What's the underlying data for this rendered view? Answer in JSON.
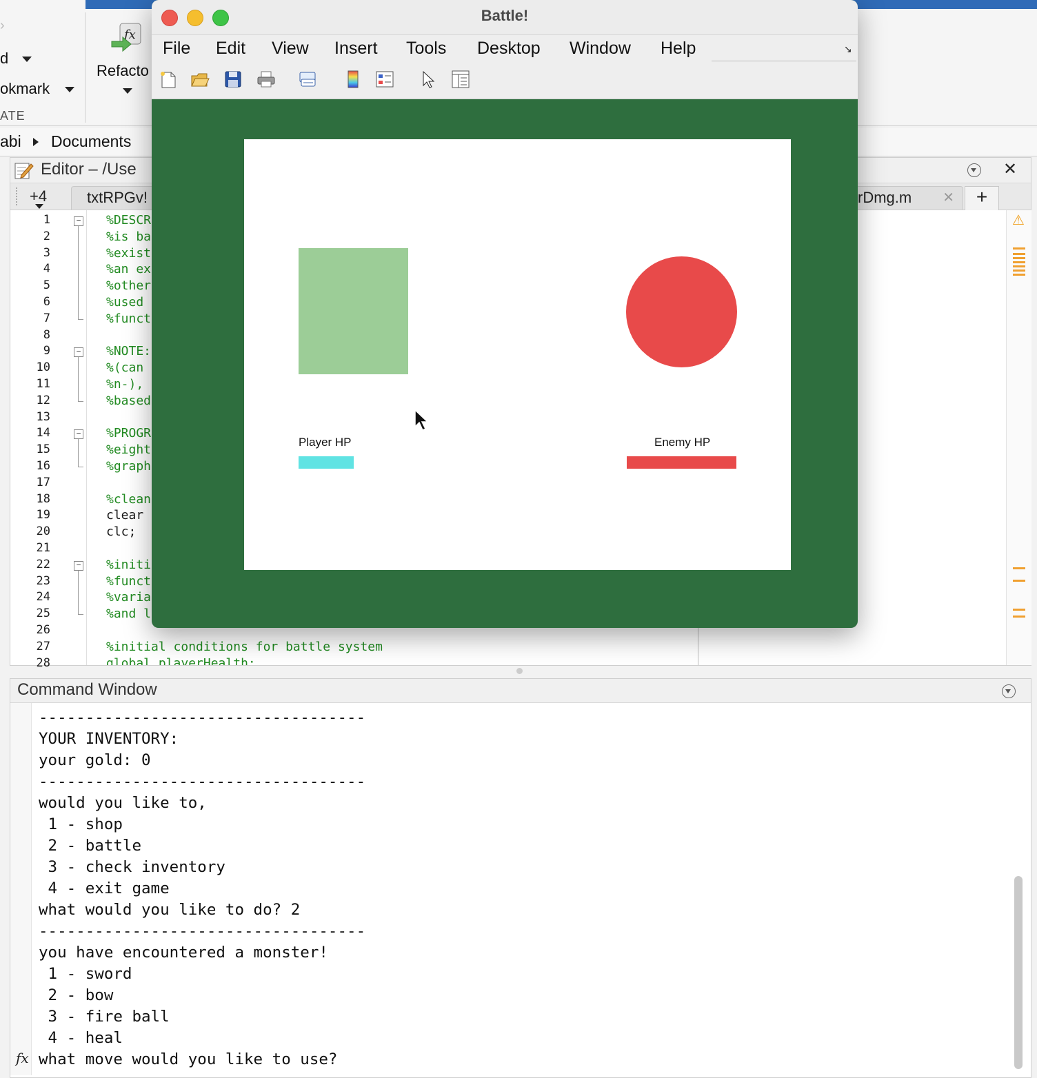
{
  "toolstrip": {
    "item1": "d",
    "item2": "okmark",
    "section": "ATE",
    "refactor_label": "Refacto"
  },
  "addressbar": {
    "crumb1": "abi",
    "crumb2": "Documents"
  },
  "editor": {
    "title": "Editor – /Use",
    "tab_more": "+4",
    "tab1": "txtRPGv!",
    "tab2": "rDmg.m",
    "lines": [
      {
        "n": "1",
        "text": "%DESCR",
        "type": "cmt"
      },
      {
        "n": "2",
        "text": "%is ba",
        "type": "cmt"
      },
      {
        "n": "3",
        "text": "%exist",
        "type": "cmt"
      },
      {
        "n": "4",
        "text": "%an ex",
        "type": "cmt"
      },
      {
        "n": "5",
        "text": "%other",
        "type": "cmt"
      },
      {
        "n": "6",
        "text": "%used ",
        "type": "cmt"
      },
      {
        "n": "7",
        "text": "%funct",
        "type": "cmt"
      },
      {
        "n": "8",
        "text": "",
        "type": "cmt"
      },
      {
        "n": "9",
        "text": "%NOTE:",
        "type": "cmt"
      },
      {
        "n": "10",
        "text": "%(can ",
        "type": "cmt"
      },
      {
        "n": "11",
        "text": "%n-),",
        "type": "cmt"
      },
      {
        "n": "12",
        "text": "%based",
        "type": "cmt"
      },
      {
        "n": "13",
        "text": "",
        "type": "cmt"
      },
      {
        "n": "14",
        "text": "%PROGR",
        "type": "cmt"
      },
      {
        "n": "15",
        "text": "%eight",
        "type": "cmt"
      },
      {
        "n": "16",
        "text": "%graph",
        "type": "cmt"
      },
      {
        "n": "17",
        "text": "",
        "type": "cmt"
      },
      {
        "n": "18",
        "text": "%clean",
        "type": "cmt"
      },
      {
        "n": "19",
        "text": "clear ",
        "type": "kw"
      },
      {
        "n": "20",
        "text": "clc;",
        "type": "kw"
      },
      {
        "n": "21",
        "text": "",
        "type": "cmt"
      },
      {
        "n": "22",
        "text": "%initi",
        "type": "cmt"
      },
      {
        "n": "23",
        "text": "%funct",
        "type": "cmt"
      },
      {
        "n": "24",
        "text": "%varia",
        "type": "cmt"
      },
      {
        "n": "25",
        "text": "%and l",
        "type": "cmt"
      },
      {
        "n": "26",
        "text": "",
        "type": "cmt"
      },
      {
        "n": "27",
        "text": "%initial conditions for battle system",
        "type": "cmt"
      },
      {
        "n": "28",
        "text": "global playerHealth;",
        "type": "cmt"
      }
    ]
  },
  "command_window": {
    "title": "Command Window",
    "prompt_icon": "fx",
    "lines": [
      "-----------------------------------",
      "YOUR INVENTORY:",
      "your gold: 0",
      "-----------------------------------",
      "would you like to,",
      " 1 - shop",
      " 2 - battle",
      " 3 - check inventory",
      " 4 - exit game",
      "what would you like to do? 2",
      "-----------------------------------",
      "you have encountered a monster!",
      " 1 - sword",
      " 2 - bow",
      " 3 - fire ball",
      " 4 - heal",
      "what move would you like to use?"
    ]
  },
  "figure": {
    "title": "Battle!",
    "menus": [
      "File",
      "Edit",
      "View",
      "Insert",
      "Tools",
      "Desktop",
      "Window",
      "Help"
    ],
    "player_hp_label": "Player HP",
    "enemy_hp_label": "Enemy HP",
    "player_hp_fraction": 0.5,
    "enemy_hp_fraction": 1.0,
    "colors": {
      "background": "#2e6e3e",
      "player": "#9ccd97",
      "enemy": "#e84a4a",
      "player_hp": "#60e3e3",
      "enemy_hp": "#e84a4a"
    },
    "toolbar_icons": [
      "new-figure-icon",
      "open-file-icon",
      "save-icon",
      "print-icon",
      "link-icon",
      "colorbar-icon",
      "legend-icon",
      "pointer-icon",
      "property-inspector-icon"
    ]
  }
}
